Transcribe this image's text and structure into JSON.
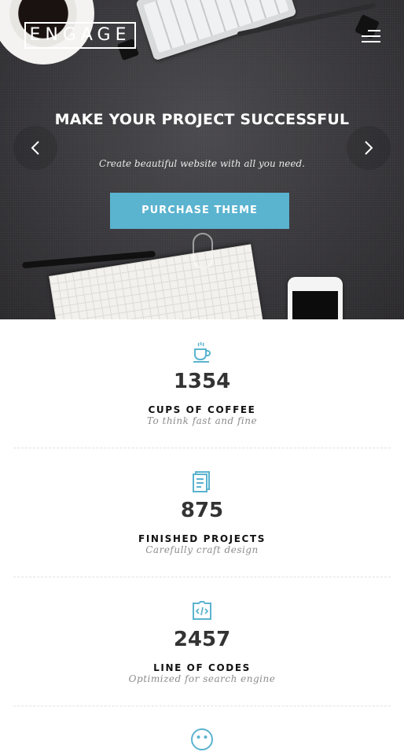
{
  "header": {
    "logo_text": "ENGAGE",
    "menu_icon": "hamburger-menu-icon"
  },
  "hero": {
    "title": "MAKE YOUR PROJECT SUCCESSFUL",
    "subtitle": "Create beautiful website with all you need.",
    "cta_label": "PURCHASE THEME",
    "prev_icon": "chevron-left-icon",
    "next_icon": "chevron-right-icon",
    "colors": {
      "accent": "#5ab3cf"
    }
  },
  "stats": [
    {
      "icon": "coffee-cup-icon",
      "number": "1354",
      "label": "CUPS OF COFFEE",
      "desc": "To think fast and fine"
    },
    {
      "icon": "document-icon",
      "number": "875",
      "label": "FINISHED PROJECTS",
      "desc": "Carefully craft design"
    },
    {
      "icon": "code-clipboard-icon",
      "number": "2457",
      "label": "LINE OF CODES",
      "desc": "Optimized for search engine"
    },
    {
      "icon": "smiley-face-icon"
    }
  ],
  "colors": {
    "icon": "#5ab3cf",
    "number": "#333333",
    "muted": "#8c8c8c"
  }
}
